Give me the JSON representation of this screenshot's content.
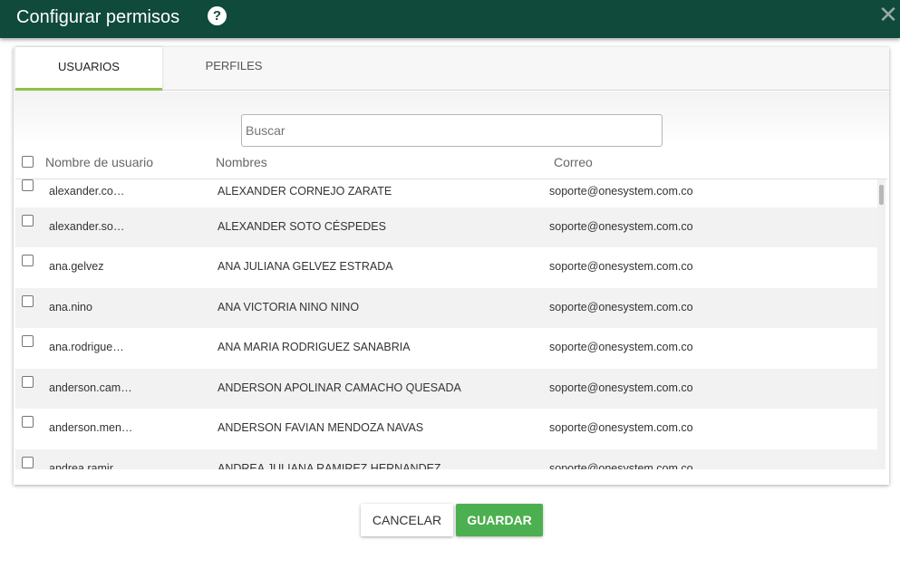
{
  "dialog": {
    "title": "Configurar permisos",
    "help_icon": "question-circle-icon",
    "help_glyph": "?",
    "close_icon": "close-icon",
    "close_glyph": "✕"
  },
  "tabs": [
    {
      "label": "USUARIOS",
      "active": true
    },
    {
      "label": "PERFILES",
      "active": false
    }
  ],
  "search": {
    "placeholder": "Buscar",
    "value": ""
  },
  "table": {
    "columns": [
      "Nombre de usuario",
      "Nombres",
      "Correo"
    ],
    "rows": [
      {
        "user": "alexander.co…",
        "name": "ALEXANDER CORNEJO ZARATE",
        "email": "soporte@onesystem.com.co"
      },
      {
        "user": "alexander.so…",
        "name": "ALEXANDER SOTO CÉSPEDES",
        "email": "soporte@onesystem.com.co"
      },
      {
        "user": "ana.gelvez",
        "name": "ANA JULIANA GELVEZ ESTRADA",
        "email": "soporte@onesystem.com.co"
      },
      {
        "user": "ana.nino",
        "name": "ANA VICTORIA NINO NINO",
        "email": "soporte@onesystem.com.co"
      },
      {
        "user": "ana.rodrigue…",
        "name": "ANA MARIA RODRIGUEZ SANABRIA",
        "email": "soporte@onesystem.com.co"
      },
      {
        "user": "anderson.cam…",
        "name": "ANDERSON APOLINAR CAMACHO QUESADA",
        "email": "soporte@onesystem.com.co"
      },
      {
        "user": "anderson.men…",
        "name": "ANDERSON FAVIAN MENDOZA NAVAS",
        "email": "soporte@onesystem.com.co"
      },
      {
        "user": "andrea.ramir…",
        "name": "ANDREA JULIANA RAMIREZ HERNANDEZ",
        "email": "soporte@onesystem.com.co"
      }
    ]
  },
  "actions": {
    "cancel_label": "CANCELAR",
    "save_label": "GUARDAR"
  },
  "colors": {
    "header": "#0f4a3a",
    "tab_indicator": "#8bc34a",
    "save_button": "#4caf50"
  }
}
